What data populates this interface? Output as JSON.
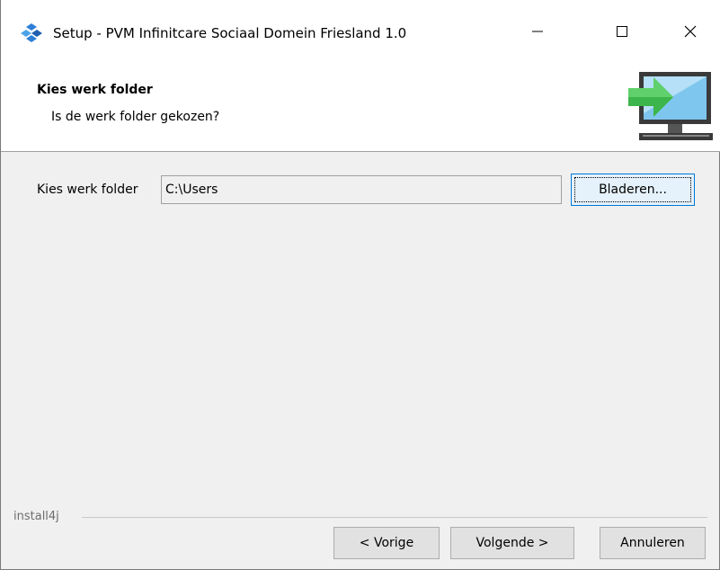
{
  "window": {
    "title": "Setup - PVM Infinitcare Sociaal Domein Friesland 1.0",
    "icons": {
      "app": "install-app-icon",
      "minimize": "minimize-icon",
      "maximize": "maximize-icon",
      "close": "close-icon"
    }
  },
  "header": {
    "title": "Kies werk folder",
    "subtitle": "Is de werk folder gekozen?",
    "icon": "monitor-arrow-icon"
  },
  "form": {
    "folder_label": "Kies werk folder",
    "folder_value": "C:\\Users",
    "browse_label": "Bladeren..."
  },
  "footer": {
    "branding": "install4j",
    "prev_label": "< Vorige",
    "next_label": "Volgende >",
    "cancel_label": "Annuleren"
  },
  "colors": {
    "accent": "#0078d7",
    "arrow": "#3cb54a",
    "screen": "#7ec6ee"
  }
}
